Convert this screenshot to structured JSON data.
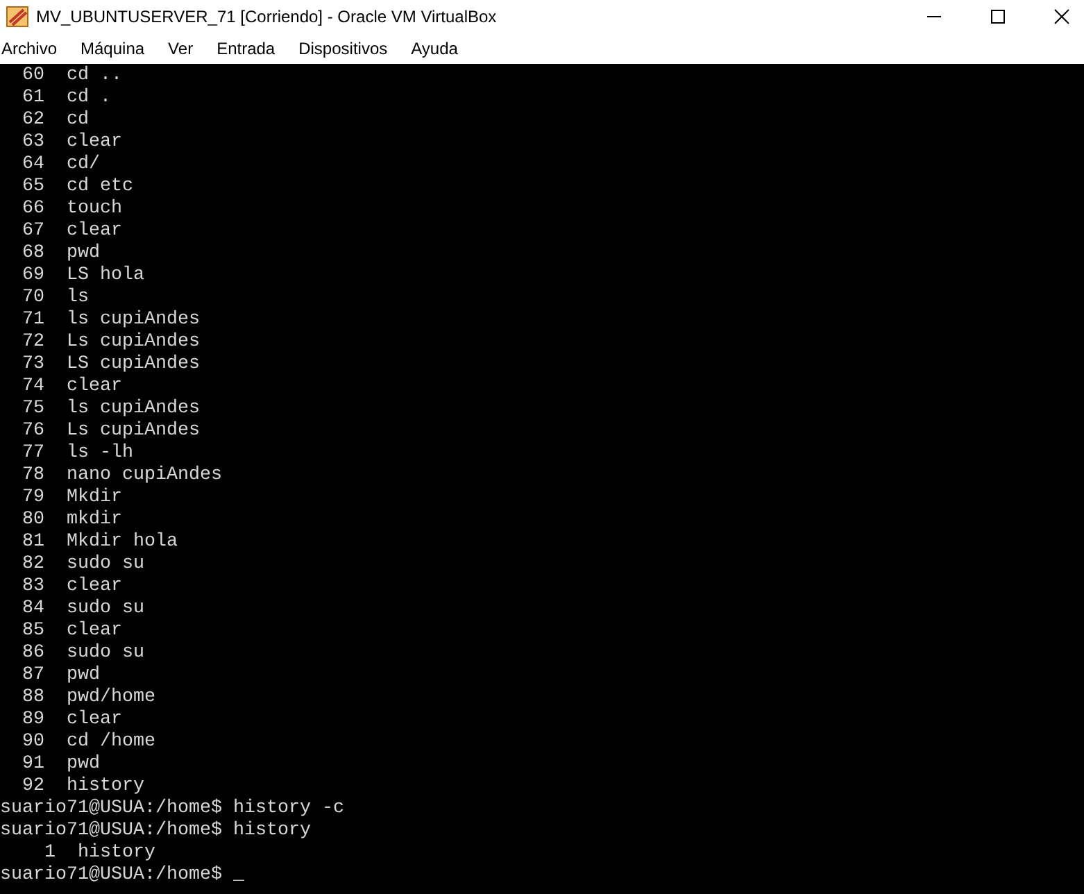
{
  "window": {
    "title": "MV_UBUNTUSERVER_71 [Corriendo] - Oracle VM VirtualBox"
  },
  "menu": [
    "Archivo",
    "Máquina",
    "Ver",
    "Entrada",
    "Dispositivos",
    "Ayuda"
  ],
  "terminal": {
    "lines": [
      "  60  cd ..",
      "  61  cd .",
      "  62  cd",
      "  63  clear",
      "  64  cd/",
      "  65  cd etc",
      "  66  touch",
      "  67  clear",
      "  68  pwd",
      "  69  LS hola",
      "  70  ls",
      "  71  ls cupiAndes",
      "  72  Ls cupiAndes",
      "  73  LS cupiAndes",
      "  74  clear",
      "  75  ls cupiAndes",
      "  76  Ls cupiAndes",
      "  77  ls -lh",
      "  78  nano cupiAndes",
      "  79  Mkdir",
      "  80  mkdir",
      "  81  Mkdir hola",
      "  82  sudo su",
      "  83  clear",
      "  84  sudo su",
      "  85  clear",
      "  86  sudo su",
      "  87  pwd",
      "  88  pwd/home",
      "  89  clear",
      "  90  cd /home",
      "  91  pwd",
      "  92  history",
      "suario71@USUA:/home$ history -c",
      "suario71@USUA:/home$ history",
      "    1  history",
      "suario71@USUA:/home$ _"
    ]
  }
}
